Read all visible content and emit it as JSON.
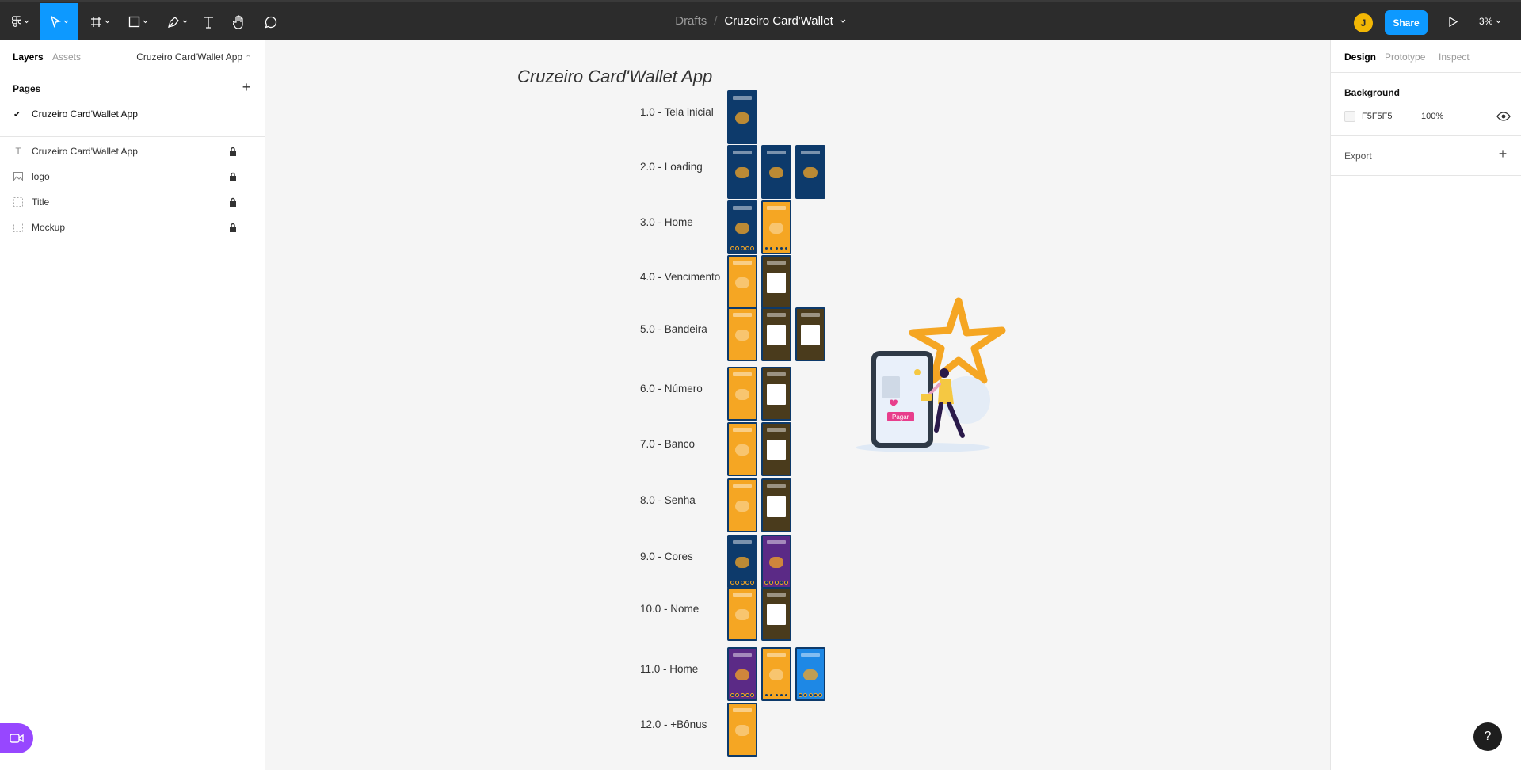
{
  "toolbar": {
    "breadcrumb_parent": "Drafts",
    "breadcrumb_separator": "/",
    "file_name": "Cruzeiro Card'Wallet",
    "user_initial": "J",
    "share_label": "Share",
    "zoom_level": "3%"
  },
  "left_panel": {
    "tabs": [
      "Layers",
      "Assets"
    ],
    "current_page_selector": "Cruzeiro Card'Wallet App",
    "pages_header": "Pages",
    "pages": [
      {
        "name": "Cruzeiro Card'Wallet App",
        "selected": true
      }
    ],
    "layers": [
      {
        "name": "Cruzeiro Card'Wallet App",
        "type": "text",
        "locked": true
      },
      {
        "name": "logo",
        "type": "image",
        "locked": true
      },
      {
        "name": "Title",
        "type": "frame",
        "locked": true
      },
      {
        "name": "Mockup",
        "type": "frame",
        "locked": true
      }
    ]
  },
  "right_panel": {
    "tabs": [
      "Design",
      "Prototype",
      "Inspect"
    ],
    "background_header": "Background",
    "background_hex": "F5F5F5",
    "background_opacity": "100%",
    "export_header": "Export"
  },
  "canvas": {
    "title": "Cruzeiro Card'Wallet App",
    "rows": [
      {
        "label": "1.0 - Tela inicial",
        "frames": [
          "navy"
        ]
      },
      {
        "label": "2.0 - Loading",
        "frames": [
          "navy",
          "navy",
          "navy"
        ]
      },
      {
        "label": "3.0 - Home",
        "frames": [
          "navy",
          "orange"
        ]
      },
      {
        "label": "4.0 - Vencimento",
        "frames": [
          "orange",
          "dark"
        ]
      },
      {
        "label": "5.0 - Bandeira",
        "frames": [
          "orange",
          "dark",
          "dark"
        ]
      },
      {
        "label": "6.0 - Número",
        "frames": [
          "orange",
          "dark"
        ]
      },
      {
        "label": "7.0 - Banco",
        "frames": [
          "orange",
          "dark"
        ]
      },
      {
        "label": "8.0 - Senha",
        "frames": [
          "orange",
          "dark"
        ]
      },
      {
        "label": "9.0 - Cores",
        "frames": [
          "navy",
          "purple"
        ]
      },
      {
        "label": "10.0 - Nome",
        "frames": [
          "orange",
          "dark"
        ]
      },
      {
        "label": "11.0 - Home",
        "frames": [
          "purple",
          "orange",
          "blue"
        ]
      },
      {
        "label": "12.0 - +Bônus",
        "frames": [
          "orange"
        ]
      }
    ],
    "illustration_button_label": "Pagar"
  },
  "colors": {
    "accent": "#0d99ff",
    "toolbar_bg": "#2c2c2c",
    "frame_navy": "#0d3a6b",
    "frame_orange": "#f5a623",
    "frame_dark": "#4a3b1c",
    "frame_purple": "#5b2a86",
    "frame_blue": "#1e88e5",
    "star": "#f5a623"
  },
  "icons": {
    "main_menu": "figma-logo-icon",
    "move": "cursor-icon",
    "frame": "hash-icon",
    "shape": "rectangle-icon",
    "pen": "pen-icon",
    "text": "text-icon",
    "hand": "hand-icon",
    "comment": "comment-icon"
  }
}
